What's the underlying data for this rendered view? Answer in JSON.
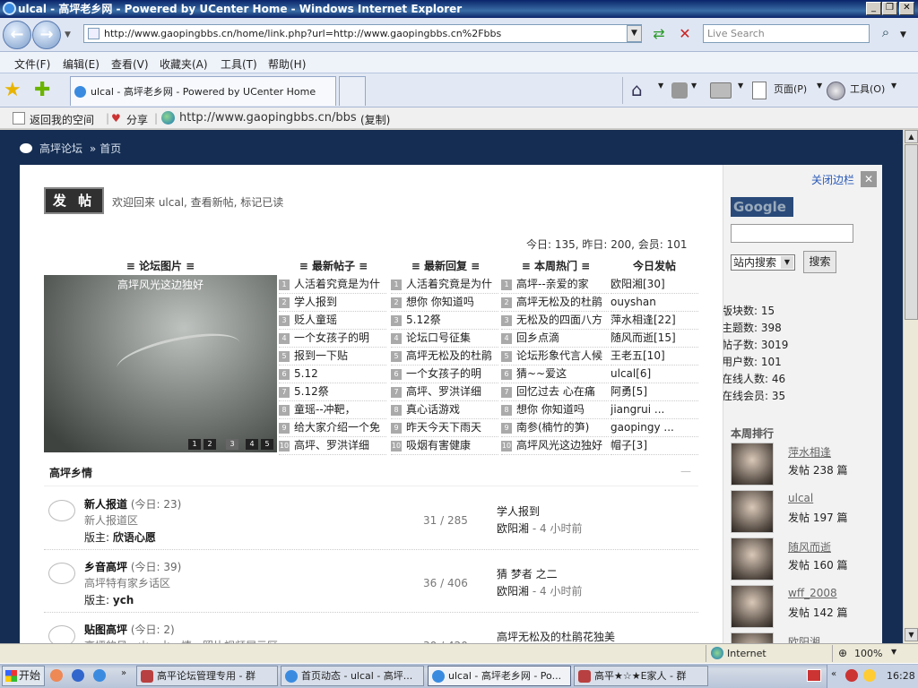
{
  "window": {
    "title": "ulcal - 高坪老乡网 - Powered by UCenter Home - Windows Internet Explorer"
  },
  "browser": {
    "url": "http://www.gaopingbbs.cn/home/link.php?url=http://www.gaopingbbs.cn%2Fbbs",
    "search_placeholder": "Live Search",
    "menu": [
      "文件(F)",
      "编辑(E)",
      "查看(V)",
      "收藏夹(A)",
      "工具(T)",
      "帮助(H)"
    ],
    "tab_title": "ulcal - 高坪老乡网 - Powered by UCenter Home",
    "toolbar": {
      "page_label": "页面(P)",
      "tools_label": "工具(O)"
    }
  },
  "bookmarks": {
    "back": "返回我的空间",
    "share": "分享",
    "link": "http://www.gaopingbbs.cn/bbs",
    "copy": "(复制)"
  },
  "breadcrumb": {
    "home": "高坪论坛",
    "sep": "»",
    "current": "首页"
  },
  "forum": {
    "post_button": "发 帖",
    "welcome": "欢迎回来 ulcal, 查看新帖, 标记已读",
    "stats_line": "今日: 135, 昨日: 200, 会员: 101",
    "photo_header": "≡ 论坛图片 ≡",
    "photo_caption": "高坪风光这边独好",
    "photo_pages": [
      "1",
      "2",
      "3",
      "4",
      "5"
    ],
    "columns": [
      {
        "header": "≡ 最新帖子 ≡",
        "items": [
          "人活着究竟是为什",
          "学人报到",
          "贬人童瑶",
          "一个女孩子的明",
          "报到一下贴",
          "5.12",
          "5.12祭",
          "童瑶--冲靶，",
          "给大家介绍一个免",
          "高坪、罗洪详细"
        ]
      },
      {
        "header": "≡ 最新回复 ≡",
        "items": [
          "人活着究竟是为什",
          "想你 你知道吗",
          "5.12祭",
          "论坛口号征集",
          "高坪无松及的杜鹃",
          "一个女孩子的明",
          "高坪、罗洪详细",
          "真心话游戏",
          "昨天今天下雨天",
          "吸烟有害健康"
        ]
      },
      {
        "header": "≡ 本周热门 ≡",
        "items": [
          "高坪--亲爱的家",
          "高坪无松及的杜鹃",
          "无松及的四面八方",
          "回乡点滴",
          "论坛形象代言人候",
          "猜~~爱这",
          "回忆过去 心在痛",
          "想你 你知道吗",
          "南参(楠竹的笋)",
          "高坪风光这边独好"
        ]
      },
      {
        "header": "今日发帖",
        "items": [
          "欧阳湘[30]",
          "ouyshan",
          "萍水相逢[22]",
          "随风而逝[15]",
          "王老五[10]",
          "ulcal[6]",
          "阿勇[5]",
          "jiangrui ...",
          "gaopingy ...",
          "帽子[3]"
        ]
      }
    ],
    "section_title": "高坪乡情",
    "section_collapse": "—",
    "boards": [
      {
        "name": "新人报道",
        "today": "(今日: 23)",
        "desc": "新人报道区",
        "mod_label": "版主:",
        "mod": "欣语心愿",
        "stats": "31 / 285",
        "last_post": "学人报到",
        "last_by": "欧阳湘",
        "last_time": "- 4 小时前"
      },
      {
        "name": "乡音高坪",
        "today": "(今日: 39)",
        "desc": "高坪特有家乡话区",
        "mod_label": "版主:",
        "mod": "ych",
        "stats": "36 / 406",
        "last_post": "猜 梦者 之二",
        "last_by": "欧阳湘",
        "last_time": "- 4 小时前"
      },
      {
        "name": "贴图高坪",
        "today": "(今日: 2)",
        "desc": "高坪的风、山、水、情，照片视频展示区",
        "mod_label": "",
        "mod": "",
        "stats": "30 / 420",
        "last_post": "高坪无松及的杜鹃花独美",
        "last_by": "",
        "last_time": ""
      }
    ]
  },
  "sidebar": {
    "close": "关闭边栏",
    "google": "Google",
    "search_scope": "站内搜索",
    "search_button": "搜索",
    "stats": [
      "版块数: 15",
      "主题数: 398",
      "帖子数: 3019",
      "用户数: 101",
      "在线人数: 46",
      "在线会员: 35"
    ],
    "ranking_title": "本周排行",
    "ranking": [
      {
        "name": "萍水相逢",
        "posts": "发帖 238 篇"
      },
      {
        "name": "ulcal",
        "posts": "发帖 197 篇"
      },
      {
        "name": "随风而逝",
        "posts": "发帖 160 篇"
      },
      {
        "name": "wff_2008",
        "posts": "发帖 142 篇"
      },
      {
        "name": "欧阳湘",
        "posts": ""
      }
    ]
  },
  "status": {
    "zone": "Internet",
    "zoom": "100%"
  },
  "taskbar": {
    "start": "开始",
    "tasks": [
      "高平论坛管理专用 - 群",
      "首页动态 - ulcal - 高坪...",
      "ulcal - 高坪老乡网 - Po...",
      "高平★☆★E家人 - 群"
    ],
    "clock": "16:28"
  }
}
